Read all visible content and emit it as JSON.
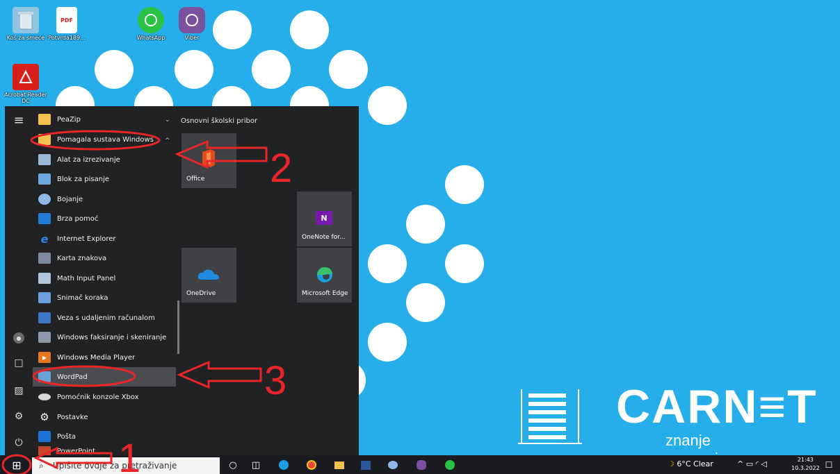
{
  "desktop": {
    "background": "#25aee9",
    "icons": [
      {
        "label": "Koš za smeće",
        "icon": "recycle-bin-icon"
      },
      {
        "label": "Potvrda189...",
        "icon": "pdf-file-icon"
      },
      {
        "label": "WhatsApp",
        "icon": "whatsapp-icon"
      },
      {
        "label": "Viber",
        "icon": "viber-icon"
      },
      {
        "label": "Acrobat Reader DC",
        "icon": "acrobat-reader-icon"
      }
    ],
    "pdf_badge": "PDF",
    "logo": {
      "name": "CARN≡T",
      "tagline": "znanje povezuje"
    }
  },
  "start_menu": {
    "apps": [
      {
        "label": "PeaZip",
        "icon": "folder-icon",
        "chevron": "⌄"
      },
      {
        "label": "Pomagala sustava Windows",
        "icon": "folder-icon",
        "chevron": "^"
      },
      {
        "label": "Alat za izrezivanje",
        "icon": "snipping-tool-icon"
      },
      {
        "label": "Blok za pisanje",
        "icon": "notepad-icon"
      },
      {
        "label": "Bojanje",
        "icon": "paint-icon"
      },
      {
        "label": "Brza pomoć",
        "icon": "quick-assist-icon"
      },
      {
        "label": "Internet Explorer",
        "icon": "internet-explorer-icon",
        "glyph": "e"
      },
      {
        "label": "Karta znakova",
        "icon": "character-map-icon"
      },
      {
        "label": "Math Input Panel",
        "icon": "math-input-panel-icon"
      },
      {
        "label": "Snimač koraka",
        "icon": "steps-recorder-icon"
      },
      {
        "label": "Veza s udaljenim računalom",
        "icon": "remote-desktop-icon"
      },
      {
        "label": "Windows faksiranje i skeniranje",
        "icon": "fax-scan-icon"
      },
      {
        "label": "Windows Media Player",
        "icon": "media-player-icon",
        "glyph": "▶"
      },
      {
        "label": "WordPad",
        "icon": "wordpad-icon"
      },
      {
        "label": "Pomoćnik konzole Xbox",
        "icon": "xbox-icon"
      },
      {
        "label": "Postavke",
        "icon": "settings-icon",
        "glyph": "⚙"
      },
      {
        "label": "Pošta",
        "icon": "mail-icon"
      },
      {
        "label": "PowerPoint",
        "icon": "powerpoint-icon"
      }
    ],
    "rail": {
      "menu_glyph": "≡",
      "user_glyph": "●",
      "documents_glyph": "□",
      "pictures_glyph": "▨",
      "settings_glyph": "⚙",
      "power_glyph": "⏻"
    },
    "tiles_header": "Osnovni školski pribor",
    "tiles": [
      {
        "label": "Office",
        "icon": "office-icon"
      },
      {
        "label": "OneNote for...",
        "icon": "onenote-icon",
        "glyph": "N"
      },
      {
        "label": "OneDrive",
        "icon": "onedrive-icon"
      },
      {
        "label": "Microsoft Edge",
        "icon": "edge-icon"
      }
    ]
  },
  "annotations": {
    "step1": "1",
    "step2": "2",
    "step3": "3",
    "color": "#e8262a"
  },
  "taskbar": {
    "search_placeholder": "Upišite ovdje za pretraživanje",
    "search_glyph": "⌕",
    "start_glyph": "⊞",
    "cortana_glyph": "○",
    "taskview_glyph": "◫",
    "weather": "6°C  Clear",
    "tray_icons": "^  ▭  ◜  ◁",
    "time": "21:43",
    "date": "10.3.2022",
    "notifications_glyph": "☐"
  }
}
